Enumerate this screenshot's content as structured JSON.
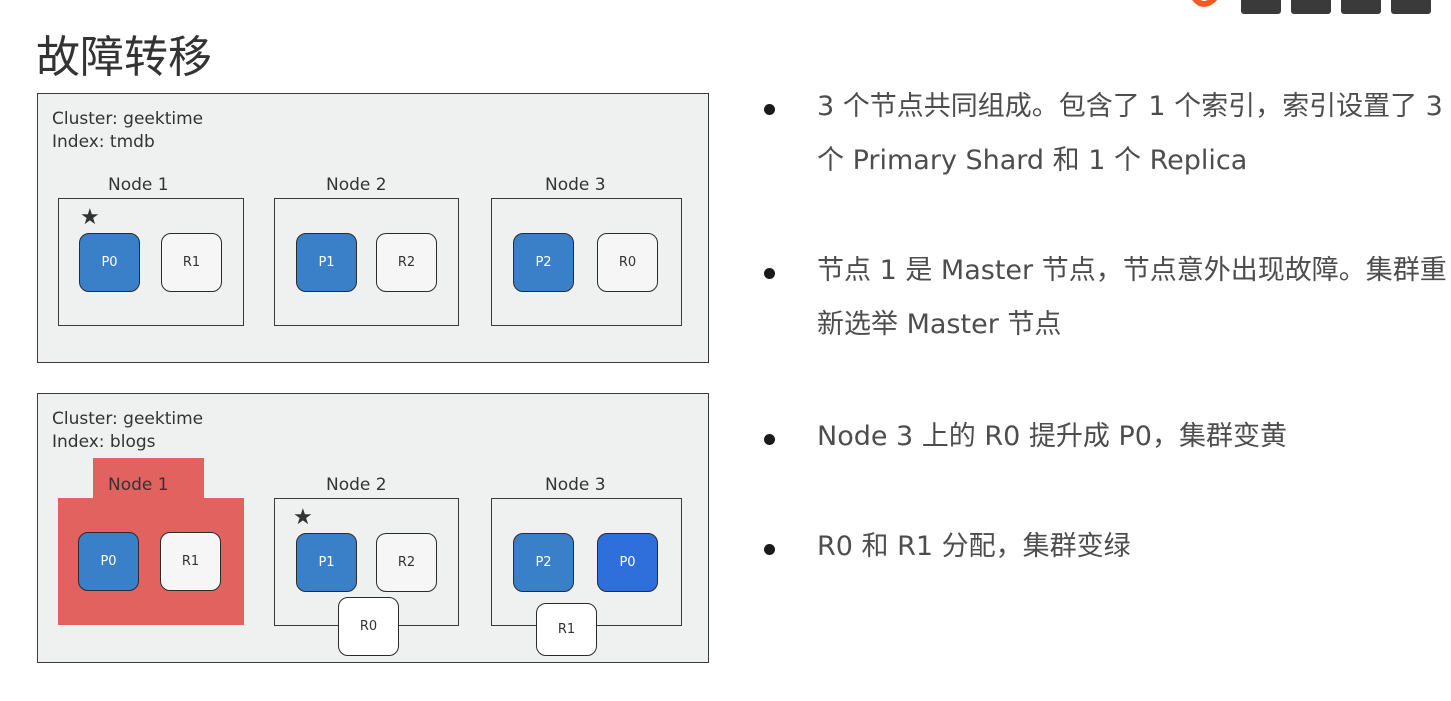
{
  "title": "故障转移",
  "colors": {
    "primary_shard": "#3a80c9",
    "primary_shard_promoted": "#2f6fdc",
    "replica_shard": "#f6f6f6",
    "failed_node": "#e2625f",
    "cluster_bg": "#eff0f0",
    "logo_orange": "#f15a24"
  },
  "diagram": {
    "top": {
      "cluster_label": "Cluster: geektime",
      "index_label": "Index: tmdb",
      "nodes": [
        {
          "label": "Node 1",
          "shards": [
            "P0",
            "R1"
          ],
          "master": true
        },
        {
          "label": "Node 2",
          "shards": [
            "P1",
            "R2"
          ],
          "master": false
        },
        {
          "label": "Node 3",
          "shards": [
            "P2",
            "R0"
          ],
          "master": false
        }
      ]
    },
    "bottom": {
      "cluster_label": "Cluster: geektime",
      "index_label": "Index: blogs",
      "nodes": [
        {
          "label": "Node 1",
          "shards": [
            "P0",
            "R1"
          ],
          "failed": true
        },
        {
          "label": "Node 2",
          "shards": [
            "P1",
            "R2"
          ],
          "master": true,
          "allocating": "R0"
        },
        {
          "label": "Node 3",
          "shards": [
            "P2",
            "P0"
          ],
          "allocating": "R1"
        }
      ]
    },
    "star_glyph": "★"
  },
  "bullets": [
    "3 个节点共同组成。包含了 1 个索引，索引设置了 3 个 Primary Shard 和 1 个 Replica",
    "节点 1 是 Master 节点，节点意外出现故障。集群重新选举 Master 节点",
    "Node 3 上的 R0 提升成 P0，集群变黄",
    "R0 和 R1 分配，集群变绿"
  ]
}
